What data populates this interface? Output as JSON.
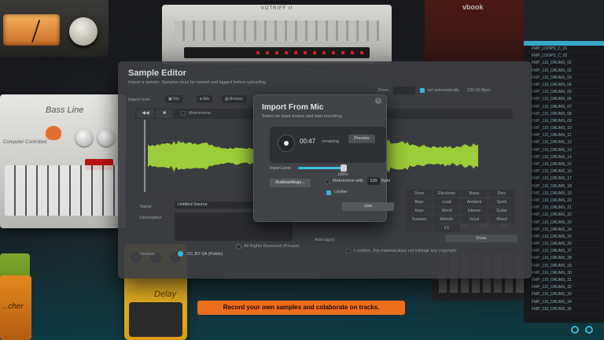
{
  "caption": "Record your own samples and colaborate on tracks.",
  "background": {
    "top_unit_title": "VOTRIFF II",
    "bassline_title": "Bass Line",
    "bassline_subtitle": "Computer Controlled",
    "pedal_orange_label": "...cher",
    "pedal_yellow_label": "Delay",
    "brand": "vbook"
  },
  "browser": {
    "items": [
      "FMP_LOOPS_C_01",
      "FMP_LOOPS_C_02",
      "FMP_110_DRUMS_01",
      "FMP_110_DRUMS_02",
      "FMP_110_DRUMS_03",
      "FMP_110_DRUMS_04",
      "FMP_110_DRUMS_05",
      "FMP_110_DRUMS_06",
      "FMP_110_DRUMS_07",
      "FMP_110_DRUMS_08",
      "FMP_110_DRUMS_09",
      "FMP_110_DRUMS_10",
      "FMP_110_DRUMS_11",
      "FMP_110_DRUMS_12",
      "FMP_110_DRUMS_13",
      "FMP_110_DRUMS_14",
      "FMP_110_DRUMS_15",
      "FMP_110_DRUMS_16",
      "FMP_110_DRUMS_17",
      "FMP_110_DRUMS_18",
      "FMP_110_DRUMS_19",
      "FMP_110_DRUMS_20",
      "FMP_110_DRUMS_21",
      "FMP_110_DRUMS_22",
      "FMP_110_DRUMS_23",
      "FMP_110_DRUMS_24",
      "FMP_110_DRUMS_25",
      "FMP_110_DRUMS_26",
      "FMP_110_DRUMS_27",
      "FMP_110_DRUMS_28",
      "FMP_110_DRUMS_29",
      "FMP_110_DRUMS_30",
      "FMP_110_DRUMS_31",
      "FMP_110_DRUMS_32",
      "FMP_110_DRUMS_33",
      "FMP_110_DRUMS_34",
      "FMP_110_DRUMS_35"
    ]
  },
  "editor": {
    "title": "Sample Editor",
    "subtitle": "Import a sample. Samples must be named and tagged before uploading.",
    "import_from_label": "Import from",
    "import_file": "File",
    "import_mic": "Mic",
    "import_browse": "Browse",
    "zoom_label": "Zoom",
    "set_automatically": "set automatically",
    "bpm_value": "120.00 Bpm",
    "metronome": "Metronome",
    "name_label": "Name",
    "name_value": "Untitled Source",
    "description_label": "Description",
    "license_label": "License",
    "license_cc": "CC BY-SA (Public)",
    "license_all": "All Rights Reserved (Private)",
    "add_tags_label": "Add tag(s)",
    "confirm_text": "I confirm, this material does not infringe any copyright",
    "done": "Done",
    "tags": [
      "Drum",
      "Electronic",
      "Brass",
      "Perc",
      "Bass",
      "Lead",
      "Ambient",
      "Synth",
      "Keys",
      "World",
      "Intense",
      "Guitar",
      "Textures",
      "Melodic",
      "Vocal",
      "Mixed",
      "",
      "FX"
    ]
  },
  "modal": {
    "title": "Import From Mic",
    "subtitle": "Select an input source and start recording",
    "close": "×",
    "time": "00:47",
    "remaining": "remaining",
    "preview": "Preview",
    "input_level_label": "Input Level",
    "input_level_pct": "100%",
    "input_level_value": 1.0,
    "audio_settings": "Audiosettings...",
    "metronome_label": "Metronome with",
    "bpm": "120",
    "bpm_label": "Bpm",
    "limiter_label": "Limiter",
    "metronome_checked": false,
    "limiter_checked": true,
    "use": "Use"
  },
  "colors": {
    "accent": "#3bb3d6",
    "waveform": "#9ccd3a",
    "caption_bg": "#ef6d1e"
  }
}
